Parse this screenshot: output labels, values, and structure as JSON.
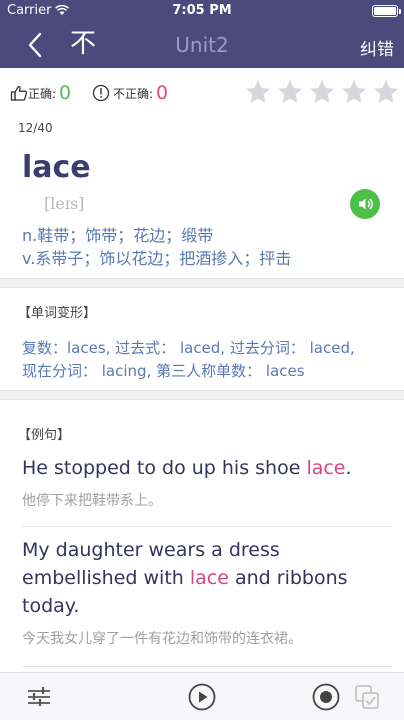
{
  "status_bar": {
    "carrier": "Carrier",
    "time": "7:05 PM"
  },
  "nav": {
    "back_icon": "chevron-left-icon",
    "unmark_glyph": "不",
    "title": "Unit2",
    "correct_label": "纠错"
  },
  "score": {
    "correct_label": "正确:",
    "correct_count": "0",
    "wrong_label": "不正确:",
    "wrong_count": "0",
    "stars_total": 5,
    "stars_filled": 0
  },
  "progress": "12/40",
  "word": {
    "headword": "lace",
    "phonetic": "[leɪs]",
    "definitions": [
      "n.鞋带；饰带；花边；缎带",
      "v.系带子；饰以花边；把酒掺入；抨击"
    ]
  },
  "word_forms": {
    "heading": "【单词变形】",
    "line1": "复数：laces, 过去式： laced, 过去分词： laced,",
    "line2": "现在分词： lacing, 第三人称单数： laces"
  },
  "examples": {
    "heading": "【例句】",
    "items": [
      {
        "before": "He stopped to do up his shoe ",
        "highlight": "lace",
        "after": ".",
        "translation": "他停下来把鞋带系上。"
      },
      {
        "before": "My daughter wears a dress embellished with ",
        "highlight": "lace",
        "after": " and ribbons today.",
        "translation": "今天我女儿穿了一件有花边和饰带的连衣裙。"
      }
    ]
  },
  "colors": {
    "nav_bg": "#4a4a7d",
    "accent_pink": "#d64682",
    "correct_green": "#5cb85c",
    "wrong_pink": "#e94b83",
    "sound_green": "#4bbf47",
    "definition_blue": "#5a78b5"
  },
  "toolbar": {
    "icons": [
      "settings-sliders-icon",
      "play-icon",
      "record-icon",
      "compare-icon"
    ]
  }
}
